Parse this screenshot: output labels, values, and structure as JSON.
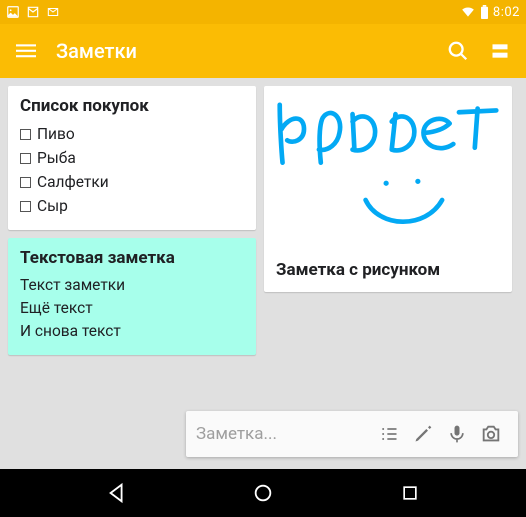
{
  "status": {
    "time": "8:02"
  },
  "appbar": {
    "title": "Заметки"
  },
  "notes": {
    "checklist": {
      "title": "Список покупок",
      "items": [
        "Пиво",
        "Рыба",
        "Салфетки",
        "Сыр"
      ]
    },
    "text": {
      "title": "Текстовая заметка",
      "lines": [
        "Текст заметки",
        "Ещё текст",
        " И снова текст"
      ]
    },
    "drawing": {
      "title": "Заметка с рисунком",
      "handwriting": "привет"
    }
  },
  "input": {
    "placeholder": "Заметка..."
  },
  "colors": {
    "accent": "#fbbc04",
    "statusbar": "#f4b400",
    "teal": "#a7ffeb",
    "drawing_stroke": "#03a9f4"
  }
}
